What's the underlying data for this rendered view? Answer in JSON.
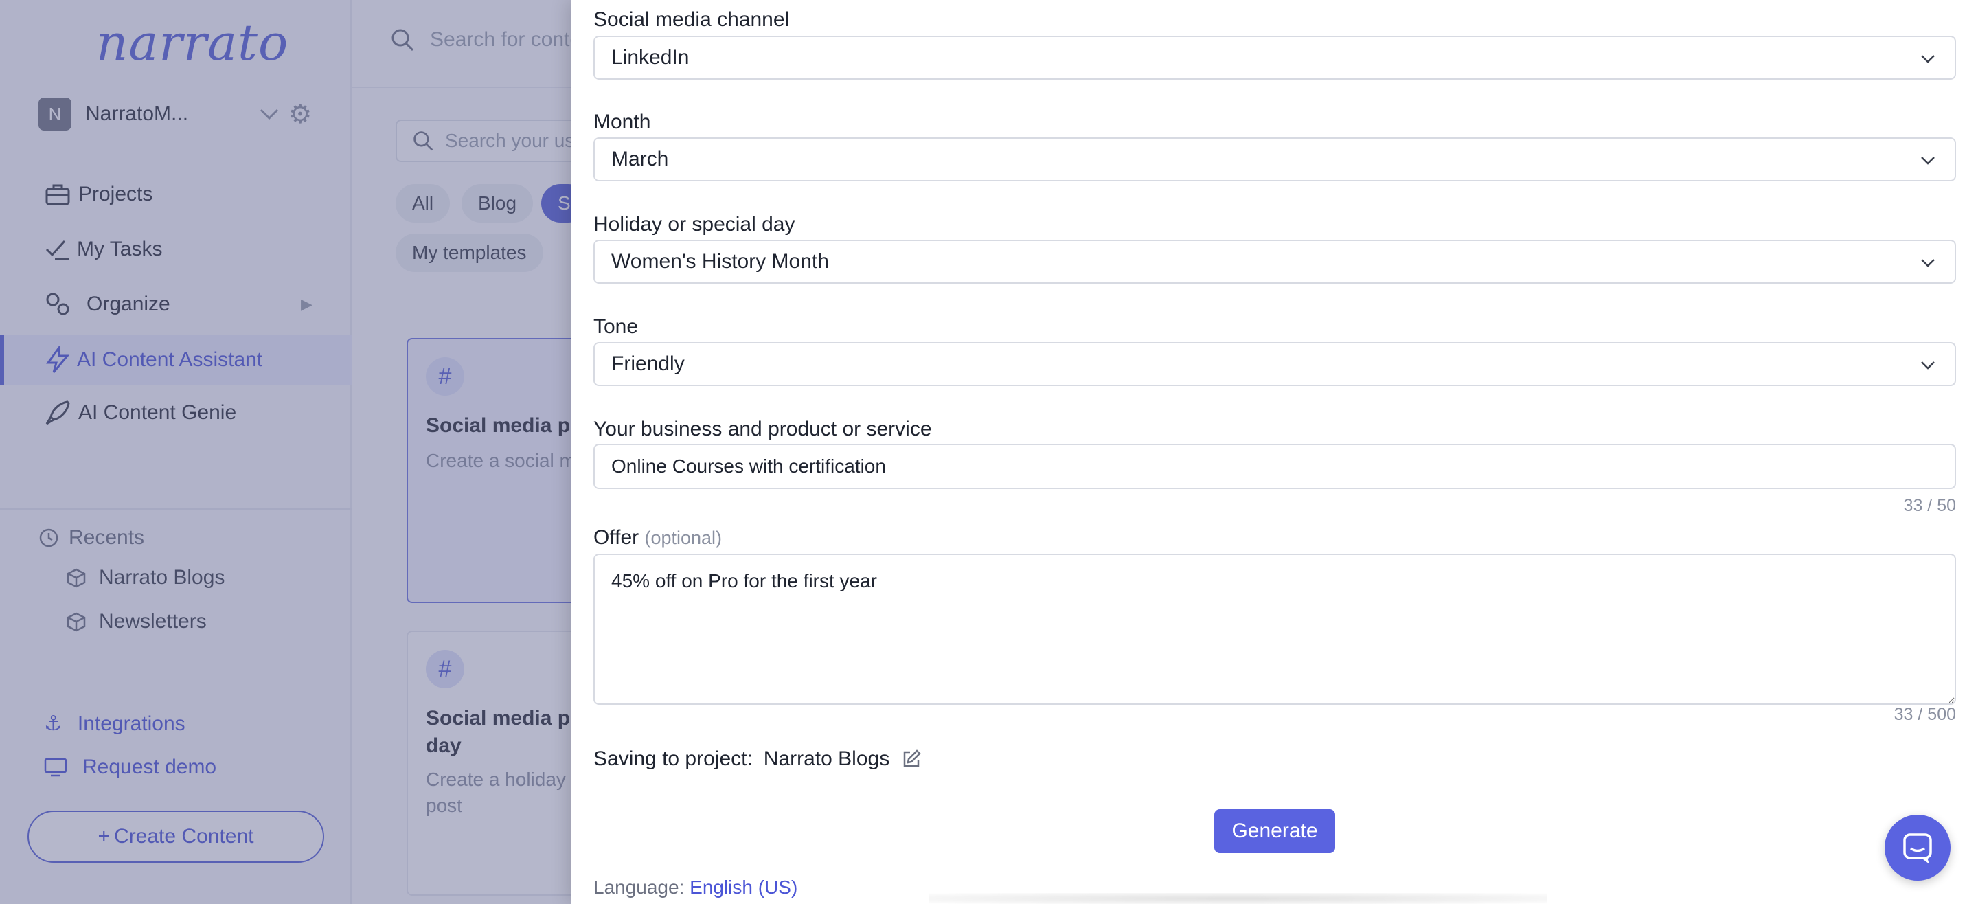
{
  "sidebar": {
    "logo": "narrato",
    "workspace": {
      "initial": "N",
      "name": "NarratoM..."
    },
    "nav": [
      {
        "label": "Projects"
      },
      {
        "label": "My Tasks"
      },
      {
        "label": "Organize"
      },
      {
        "label": "AI Content Assistant",
        "active": true
      },
      {
        "label": "AI Content Genie"
      }
    ],
    "recents": {
      "title": "Recents",
      "items": [
        "Narrato Blogs",
        "Newsletters"
      ]
    },
    "links": [
      "Integrations",
      "Request demo"
    ],
    "create_button": "Create Content"
  },
  "main": {
    "top_search_placeholder": "Search for conte",
    "template_search_placeholder": "Search your us",
    "filters": [
      "All",
      "Blog",
      "S",
      "My templates"
    ],
    "cards": [
      {
        "title": "Social media po",
        "desc": "Create a social m"
      },
      {
        "title": "Social media po special day",
        "desc": "Create a holiday o media post"
      }
    ]
  },
  "form": {
    "channel": {
      "label": "Social media channel",
      "value": "LinkedIn"
    },
    "month": {
      "label": "Month",
      "value": "March"
    },
    "holiday": {
      "label": "Holiday or special day",
      "value": "Women's History Month"
    },
    "tone": {
      "label": "Tone",
      "value": "Friendly"
    },
    "business": {
      "label": "Your business and product or service",
      "value": "Online Courses with certification",
      "counter": "33 / 50"
    },
    "offer": {
      "label": "Offer",
      "optional": "(optional)",
      "value": "45% off on Pro for the first year",
      "counter": "33 / 500"
    },
    "saving": {
      "label": "Saving to project:",
      "project": "Narrato Blogs"
    },
    "generate_label": "Generate",
    "language": {
      "label": "Language:",
      "value": "English (US)"
    }
  },
  "colors": {
    "accent": "#5a63e0",
    "overlay": "rgba(90,96,140,0.45)"
  }
}
